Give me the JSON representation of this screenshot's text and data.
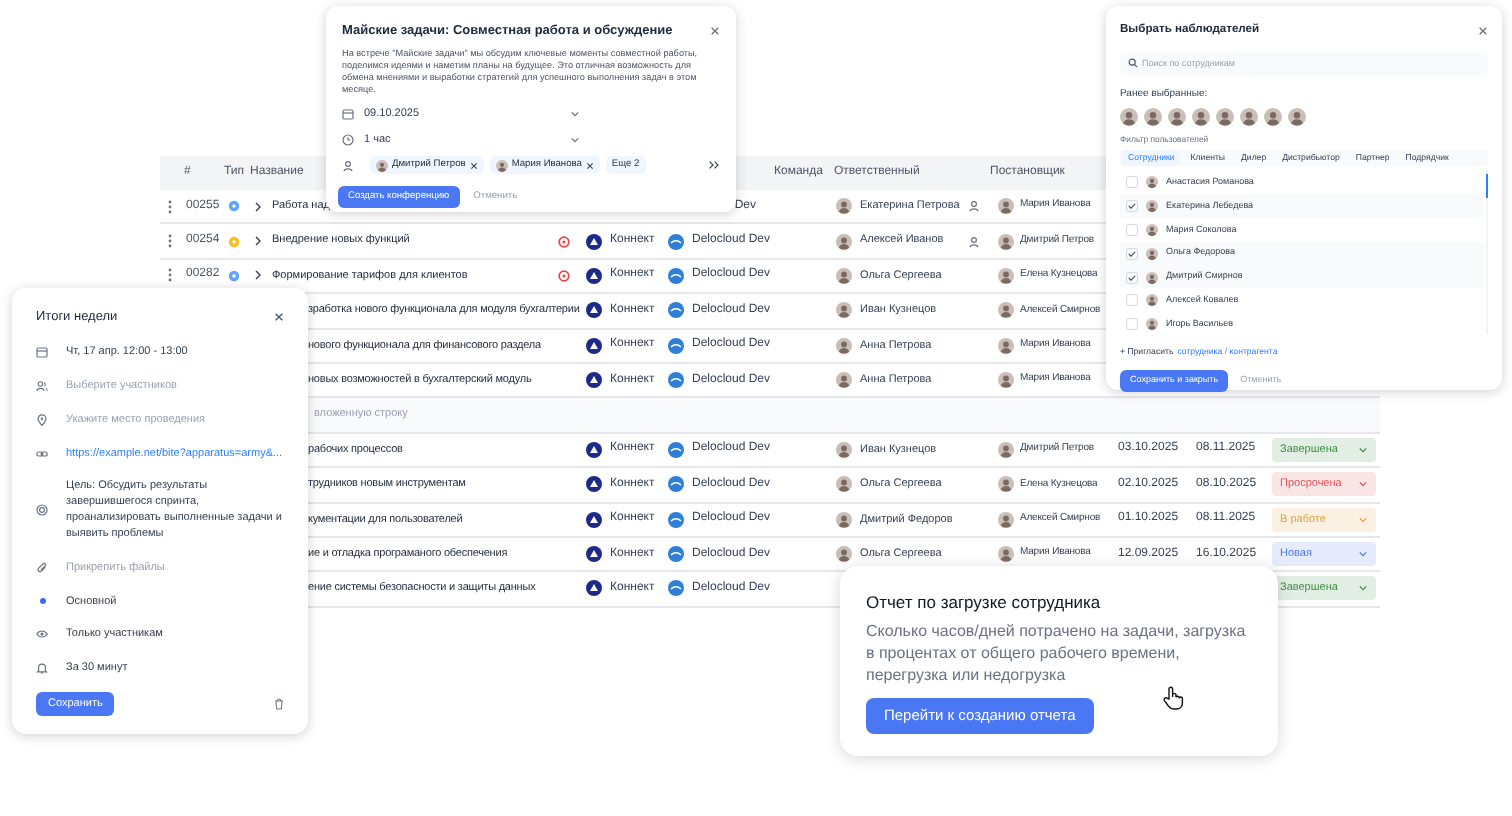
{
  "table": {
    "columns": [
      {
        "kind": "id",
        "label": "#"
      },
      {
        "kind": "type",
        "label": "Тип"
      },
      {
        "kind": "name",
        "label": "Название"
      },
      {
        "kind": "team",
        "label": "Команда"
      },
      {
        "kind": "responsible",
        "label": "Ответственный"
      },
      {
        "kind": "assigner",
        "label": "Постановщик"
      }
    ],
    "rows": [
      {
        "kind": "task",
        "id": "00255",
        "type": {
          "color": "#60a5fa"
        },
        "name": "Работа над",
        "flagged": false,
        "company": "Dev",
        "responsible": "Екатерина Петрова",
        "lead": true,
        "assigner": "Мария Иванова"
      },
      {
        "kind": "task",
        "id": "00254",
        "type": {
          "color": "#fbbf24"
        },
        "name": "Внедрение новых функций",
        "flagged": true,
        "product": "Коннект",
        "company": "Delocloud Dev",
        "responsible": "Алексей Иванов",
        "lead": true,
        "assigner": "Дмитрий Петров"
      },
      {
        "kind": "task",
        "id": "00282",
        "type": {
          "color": "#60a5fa"
        },
        "name": "Формирование тарифов для клиентов",
        "flagged": true,
        "product": "Коннект",
        "company": "Delocloud Dev",
        "responsible": "Ольга Сергеева",
        "lead": false,
        "assigner": "Елена Кузнецова"
      },
      {
        "kind": "task",
        "name": "зработка нового функционала для модуля бухгалтерии",
        "flagged": false,
        "product": "Коннект",
        "company": "Delocloud Dev",
        "responsible": "Иван Кузнецов",
        "lead": false,
        "assigner": "Алексей Смирнов"
      },
      {
        "kind": "task",
        "name": "нового функционала для финансового раздела",
        "flagged": false,
        "product": "Коннект",
        "company": "Delocloud Dev",
        "responsible": "Анна Петрова",
        "lead": false,
        "assigner": "Мария Иванова"
      },
      {
        "kind": "task",
        "name": "новых возможностей в бухгалтерский модуль",
        "flagged": false,
        "product": "Коннект",
        "company": "Delocloud Dev",
        "responsible": "Анна Петрова",
        "lead": false,
        "assigner": "Мария Иванова"
      },
      {
        "kind": "add_row",
        "name": "вложенную строку"
      },
      {
        "kind": "task",
        "name": "рабочих процессов",
        "flagged": false,
        "product": "Коннект",
        "company": "Delocloud Dev",
        "responsible": "Иван Кузнецов",
        "lead": false,
        "assigner": "Дмитрий Петров",
        "start": "03.10.2025",
        "end": "08.11.2025",
        "status": {
          "label": "Завершена",
          "color": "#3f8f46"
        }
      },
      {
        "kind": "task",
        "name": "трудников новым инструментам",
        "flagged": false,
        "product": "Коннект",
        "company": "Delocloud Dev",
        "responsible": "Ольга Сергеева",
        "lead": false,
        "assigner": "Елена Кузнецова",
        "start": "02.10.2025",
        "end": "08.10.2025",
        "status": {
          "label": "Просрочена",
          "color": "#e0525a"
        }
      },
      {
        "kind": "task",
        "name": "кументации для пользователей",
        "flagged": false,
        "product": "Коннект",
        "company": "Delocloud Dev",
        "responsible": "Дмитрий Федоров",
        "lead": false,
        "assigner": "Алексей Смирнов",
        "start": "01.10.2025",
        "end": "08.11.2025",
        "status": {
          "label": "В работе",
          "color": "#e5a13a"
        }
      },
      {
        "kind": "task",
        "name": "ие и отладка програманого обеспечения",
        "flagged": false,
        "product": "Коннект",
        "company": "Delocloud Dev",
        "responsible": "Ольга Сергеева",
        "lead": false,
        "assigner": "Мария Иванова",
        "start": "12.09.2025",
        "end": "16.10.2025",
        "status": {
          "label": "Новая",
          "color": "#4f7be8"
        }
      },
      {
        "kind": "task",
        "name": "ение системы безопасности и защиты данных",
        "flagged": false,
        "product": "Коннект",
        "company": "Delocloud Dev",
        "status": {
          "label": "Завершена",
          "color": "#3f8f46"
        }
      }
    ]
  },
  "meeting_popup": {
    "title": "Майские задачи: Совместная работа и обсуждение",
    "description": "На встрече \"Майские задачи\" мы обсудим ключевые моменты совместной работы, поделимся идеями и наметим планы на будущее. Это отличная возможность для обмена мнениями и выработки стратегий для успешного выполнения задач в этом месяце.",
    "date": "09.10.2025",
    "duration": "1 час",
    "participants": [
      "Дмитрий Петров",
      "Мария Иванова"
    ],
    "more": "Еще 2",
    "primary_button": "Создать конференцию",
    "cancel_button": "Отменить"
  },
  "observers_popup": {
    "title": "Выбрать наблюдателей",
    "search": {
      "placeholder": "Поиск по сотрудникам"
    },
    "recent_label": "Ранее выбранные:",
    "filter_label": "Фильтр пользователей",
    "tabs": [
      {
        "label": "Сотрудники",
        "selected": true
      },
      {
        "label": "Клиенты",
        "selected": false
      },
      {
        "label": "Дилер",
        "selected": false
      },
      {
        "label": "Дистрибьютор",
        "selected": false
      },
      {
        "label": "Партнер",
        "selected": false
      },
      {
        "label": "Подрядчик",
        "selected": false
      }
    ],
    "items": [
      {
        "name": "Анастасия Романова",
        "checked": false
      },
      {
        "name": "Екатерина Лебедева",
        "checked": true
      },
      {
        "name": "Мария Соколова",
        "checked": false
      },
      {
        "name": "Ольга Федорова",
        "checked": true
      },
      {
        "name": "Дмитрий Смирнов",
        "checked": true
      },
      {
        "name": "Алексей Ковалев",
        "checked": false
      },
      {
        "name": "Игорь Васильев",
        "checked": false
      }
    ],
    "invite_prefix": "+ Пригласить",
    "invite_link": "сотрудника / контрагента",
    "primary_button": "Сохранить и закрыть",
    "cancel_button": "Отменить"
  },
  "week_card": {
    "title": "Итоги недели",
    "items": [
      {
        "kind": "time",
        "text": "Чт, 17 апр. 12:00 - 13:00"
      },
      {
        "kind": "participants",
        "text": "Выберите участников"
      },
      {
        "kind": "place",
        "text": "Укажите место проведения"
      },
      {
        "kind": "link",
        "text": "https://example.net/bite?apparatus=army&..."
      },
      {
        "kind": "goal",
        "text": "Цель: Обсудить результаты завершившегося спринта, проанализировать выполненные задачи и выявить проблемы"
      },
      {
        "kind": "files",
        "text": "Прикрепить файлы"
      },
      {
        "kind": "calendar",
        "text": "Основной",
        "color": "#3b6ef5"
      },
      {
        "kind": "visibility",
        "text": "Только участникам"
      },
      {
        "kind": "reminder",
        "text": "За 30 минут"
      }
    ],
    "save_button": "Сохранить"
  },
  "report_card": {
    "title": "Отчет по загрузке сотрудника",
    "description": "Сколько часов/дней потрачено на задачи, загрузка в процентах от общего рабочего времени, перегрузка или недогрузка",
    "button": "Перейти к созданию отчета"
  }
}
